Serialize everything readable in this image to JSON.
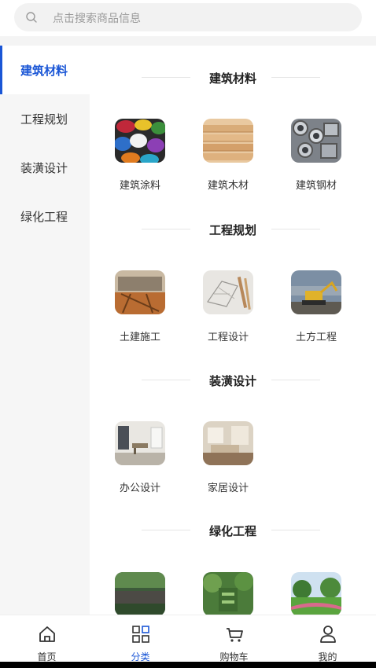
{
  "search": {
    "placeholder": "点击搜索商品信息",
    "icon": "search-icon"
  },
  "sidebar": {
    "active_color": "#1a56d6",
    "items": [
      {
        "label": "建筑材料",
        "active": true
      },
      {
        "label": "工程规划",
        "active": false
      },
      {
        "label": "装潢设计",
        "active": false
      },
      {
        "label": "绿化工程",
        "active": false
      }
    ]
  },
  "sections": [
    {
      "title": "建筑材料",
      "items": [
        {
          "name": "建筑涂料"
        },
        {
          "name": "建筑木材"
        },
        {
          "name": "建筑钢材"
        }
      ]
    },
    {
      "title": "工程规划",
      "items": [
        {
          "name": "土建施工"
        },
        {
          "name": "工程设计"
        },
        {
          "name": "土方工程"
        }
      ]
    },
    {
      "title": "装潢设计",
      "items": [
        {
          "name": "办公设计"
        },
        {
          "name": "家居设计"
        }
      ]
    },
    {
      "title": "绿化工程",
      "items": [
        {
          "name": ""
        },
        {
          "name": ""
        },
        {
          "name": ""
        }
      ]
    }
  ],
  "tabbar": {
    "items": [
      {
        "label": "首页",
        "icon": "home-icon",
        "active": false
      },
      {
        "label": "分类",
        "icon": "category-icon",
        "active": true
      },
      {
        "label": "购物车",
        "icon": "cart-icon",
        "active": false
      },
      {
        "label": "我的",
        "icon": "user-icon",
        "active": false
      }
    ]
  }
}
